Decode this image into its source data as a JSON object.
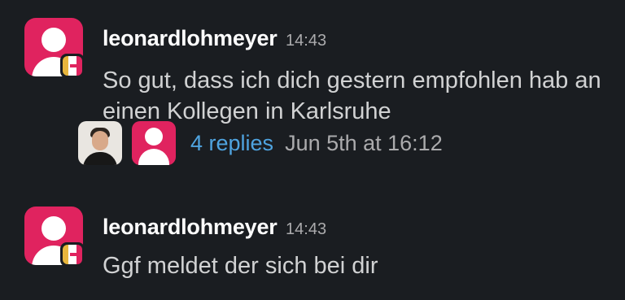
{
  "messages": [
    {
      "username": "leonardlohmeyer",
      "time": "14:43",
      "text": "So gut, dass ich dich gestern empfohlen hab an einen Kollegen in Karlsruhe",
      "thread": {
        "replies_label": "4 replies",
        "last_reply": "Jun 5th at 16:12"
      }
    },
    {
      "username": "leonardlohmeyer",
      "time": "14:43",
      "text": "Ggf meldet der sich bei dir"
    }
  ],
  "colors": {
    "background": "#1a1d21",
    "avatar": "#e0235f",
    "link": "#4fa4e0"
  },
  "icons": [
    "user-avatar-icon",
    "status-badge-icon"
  ]
}
